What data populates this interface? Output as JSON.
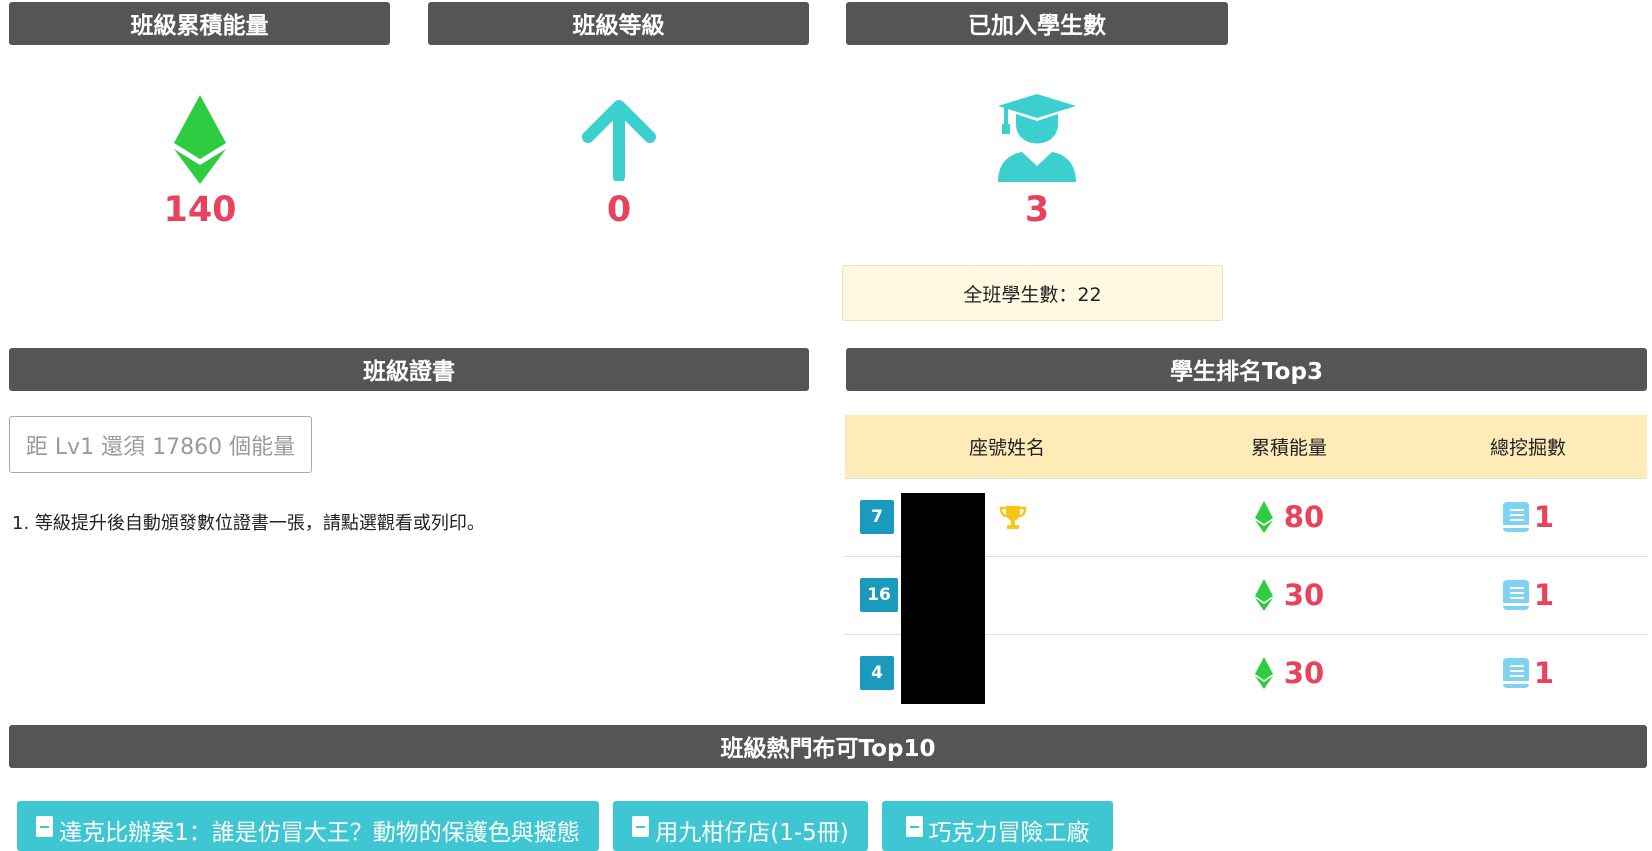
{
  "stats": {
    "energy": {
      "title": "班級累積能量",
      "value": "140"
    },
    "level": {
      "title": "班級等級",
      "value": "0"
    },
    "students": {
      "title": "已加入學生數",
      "value": "3",
      "total_label": "全班學生數：22"
    }
  },
  "certificate": {
    "title": "班級證書",
    "button_label": "距 Lv1 還須 17860 個能量",
    "note": "1. 等級提升後自動頒發數位證書一張，請點選觀看或列印。"
  },
  "ranking": {
    "title": "學生排名Top3",
    "columns": [
      "座號姓名",
      "累積能量",
      "總挖掘數"
    ],
    "rows": [
      {
        "seat": "7",
        "energy": "80",
        "dig": "1",
        "trophy": true
      },
      {
        "seat": "16",
        "energy": "30",
        "dig": "1",
        "trophy": false
      },
      {
        "seat": "4",
        "energy": "30",
        "dig": "1",
        "trophy": false
      }
    ]
  },
  "popular": {
    "title": "班級熱門布可Top10",
    "books": [
      "達克比辦案1：誰是仿冒大王？動物的保護色與擬態",
      "用九柑仔店(1-5冊)",
      "巧克力冒險工廠"
    ]
  },
  "colors": {
    "header_bg": "#555555",
    "accent_red": "#e8425f",
    "teal": "#3ccfcf",
    "energy_green": "#2ecc40",
    "seat_badge": "#1a9bbd",
    "book_button": "#3ec7d3"
  },
  "icons": {
    "energy": "ethereum-diamond-icon",
    "level": "arrow-up-icon",
    "students": "graduate-icon",
    "trophy": "trophy-icon",
    "dig": "book-icon"
  }
}
